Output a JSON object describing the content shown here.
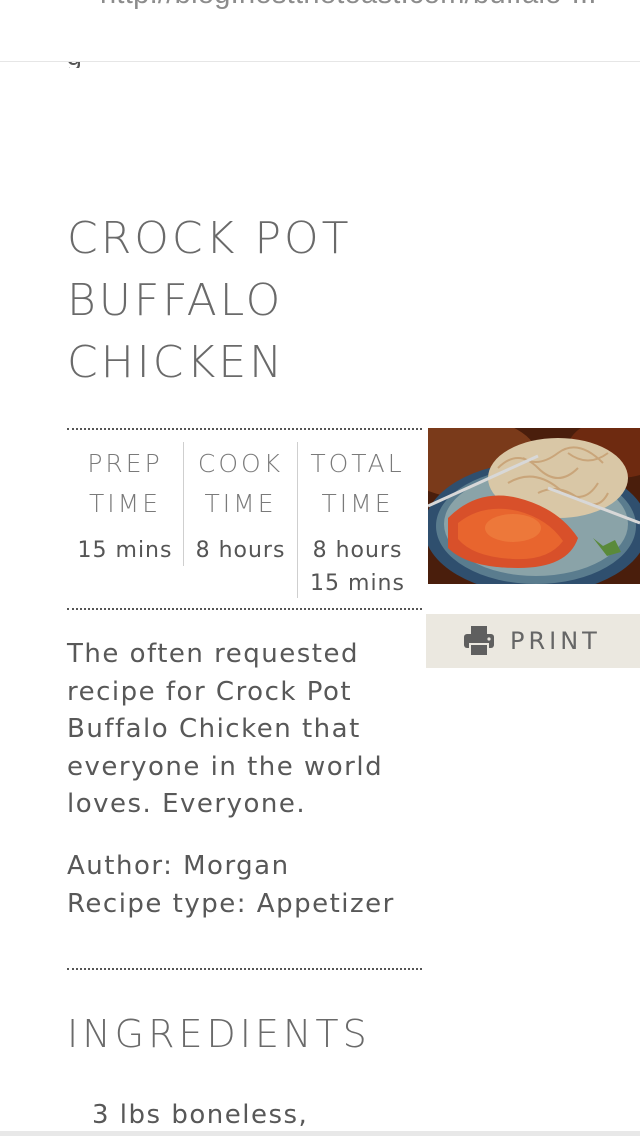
{
  "browser": {
    "url": "http://blog.hostthetoast.com/buffalo-..."
  },
  "recipe": {
    "title_lines": [
      "CROCK POT",
      "BUFFALO",
      "CHICKEN"
    ],
    "times": {
      "prep": {
        "label_1": "PREP",
        "label_2": "TIME",
        "value_1": "15 mins",
        "value_2": ""
      },
      "cook": {
        "label_1": "COOK",
        "label_2": "TIME",
        "value_1": "8 hours",
        "value_2": ""
      },
      "total": {
        "label_1": "TOTAL",
        "label_2": "TIME",
        "value_1": "8 hours",
        "value_2": "15 mins"
      }
    },
    "print_label": "PRINT",
    "description_lines": [
      "The often requested",
      "recipe for Crock Pot",
      "Buffalo Chicken that",
      "everyone in the world",
      "loves. Everyone."
    ],
    "author": "Author: Morgan",
    "recipe_type": "Recipe type: Appetizer",
    "ingredients_heading": "INGREDIENTS",
    "ingredients": [
      "3 lbs boneless,"
    ]
  },
  "icons": {
    "print": "printer-icon"
  },
  "colors": {
    "print_button_bg": "#ebe8e0",
    "text": "#585858",
    "rule": "#555555"
  }
}
